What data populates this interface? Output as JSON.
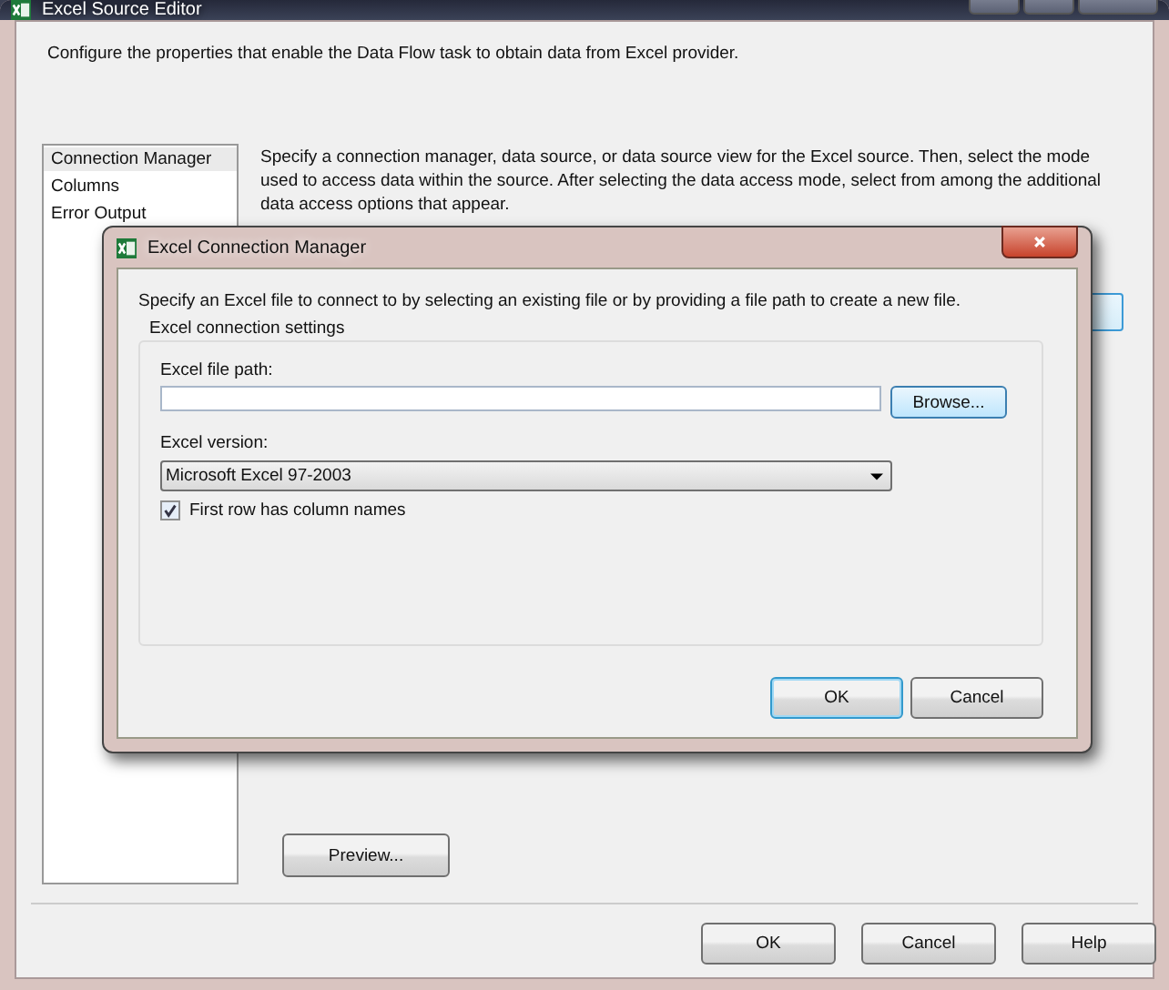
{
  "window": {
    "title": "Excel Source Editor",
    "header": "Configure the properties that enable the Data Flow task to obtain data from Excel provider."
  },
  "sidebar": {
    "items": [
      {
        "label": "Connection Manager",
        "selected": true
      },
      {
        "label": "Columns",
        "selected": false
      },
      {
        "label": "Error Output",
        "selected": false
      }
    ]
  },
  "description": "Specify a connection manager, data source, or data source view for the Excel source. Then, select the mode used to access data within the source. After selecting the data access mode, select from among the additional data access options that appear.",
  "preview_button": "Preview...",
  "buttons": [
    "OK",
    "Cancel",
    "Help"
  ],
  "dialog": {
    "title": "Excel Connection Manager",
    "instructions": "Specify an Excel file to connect to by selecting an existing file or by providing a file path to create a new file.",
    "group": "Excel connection settings",
    "file_path": {
      "label": "Excel file path:"
    },
    "browse_button": "Browse...",
    "version": {
      "label": "Excel version:",
      "value": "Microsoft Excel 97-2003"
    },
    "first_row": {
      "label": "First row has column names",
      "checked": true
    },
    "buttons": [
      {
        "label": "OK",
        "default": true
      },
      {
        "label": "Cancel",
        "default": false
      }
    ]
  }
}
